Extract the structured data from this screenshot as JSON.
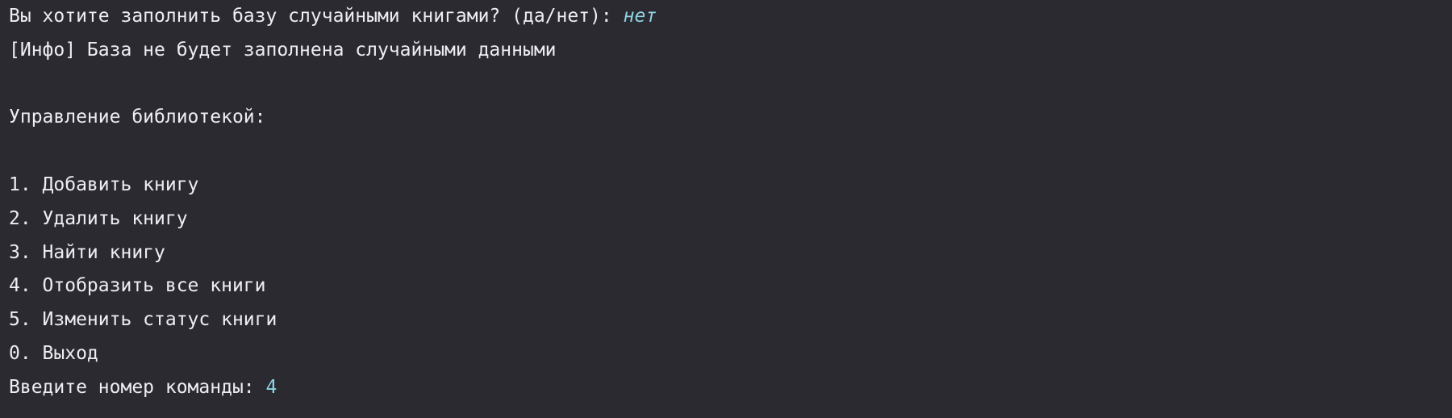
{
  "terminal": {
    "prompt_fill": "Вы хотите заполнить базу случайными книгами? (да/нет): ",
    "answer_fill": "нет",
    "info_line": "[Инфо] База не будет заполнена случайными данными",
    "menu_title": "Управление библиотекой:",
    "menu_items": [
      "1. Добавить книгу",
      "2. Удалить книгу",
      "3. Найти книгу",
      "4. Отобразить все книги",
      "5. Изменить статус книги",
      "0. Выход"
    ],
    "prompt_command": "Введите номер команды: ",
    "answer_command": "4"
  },
  "colors": {
    "background": "#2b2a31",
    "text": "#eeeef2",
    "user_input": "#8fd3e3"
  }
}
